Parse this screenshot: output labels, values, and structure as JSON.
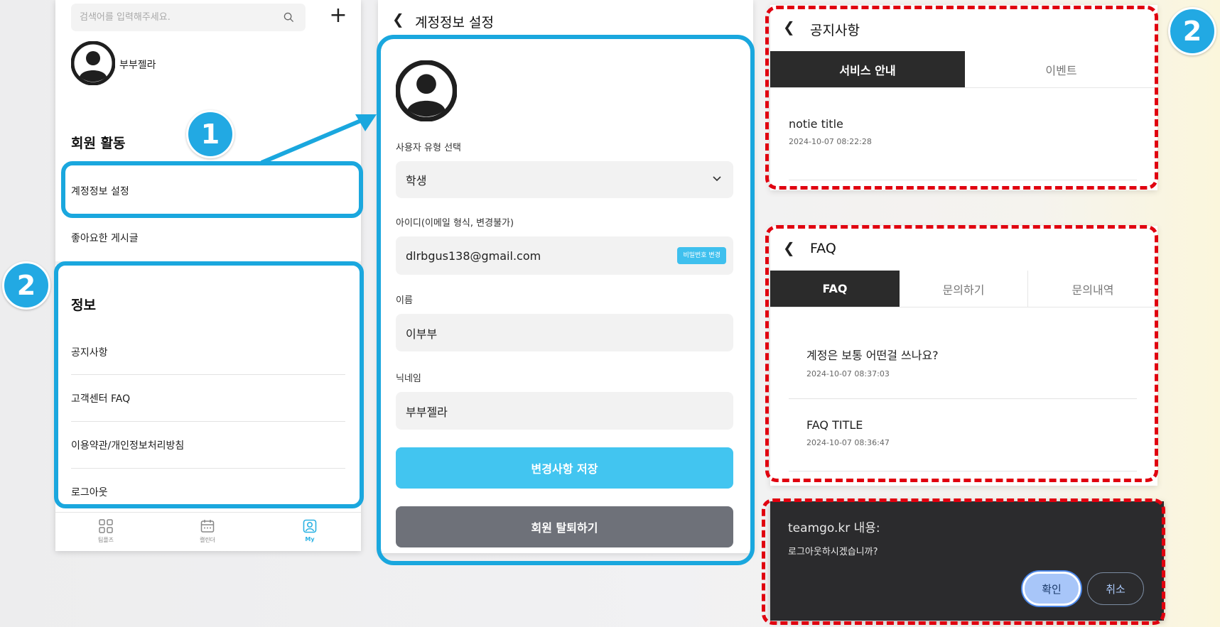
{
  "my_page": {
    "search": {
      "placeholder": "검색어를 입력해주세요."
    },
    "user": {
      "name": "부부젤라"
    },
    "sections": [
      {
        "title": "회원 활동",
        "items": [
          "계정정보 설정",
          "좋아요한 게시글"
        ]
      },
      {
        "title": "정보",
        "items": [
          "공지사항",
          "고객센터 FAQ",
          "이용약관/개인정보처리방침",
          "로그아웃"
        ]
      }
    ],
    "bottom_nav": [
      {
        "label": "팀플즈",
        "icon": "grid-icon"
      },
      {
        "label": "캘린더",
        "icon": "calendar-icon"
      },
      {
        "label": "My",
        "icon": "profile-icon",
        "active": true
      }
    ]
  },
  "account_settings": {
    "title": "계정정보 설정",
    "user_type": {
      "label": "사용자 유형 선택",
      "value": "학생"
    },
    "email": {
      "label": "아이디(이메일 형식, 변경불가)",
      "value": "dlrbgus138@gmail.com",
      "password_button": "비밀번호 변경"
    },
    "name": {
      "label": "이름",
      "value": "이부부"
    },
    "nickname": {
      "label": "닉네임",
      "value": "부부젤라"
    },
    "save_button": "변경사항 저장",
    "withdraw_button": "회원 탈퇴하기"
  },
  "notice": {
    "title": "공지사항",
    "tabs": [
      {
        "label": "서비스 안내",
        "active": true
      },
      {
        "label": "이벤트",
        "active": false
      }
    ],
    "posts": [
      {
        "title": "notie title",
        "date": "2024-10-07 08:22:28"
      }
    ]
  },
  "faq": {
    "title": "FAQ",
    "tabs": [
      {
        "label": "FAQ",
        "active": true
      },
      {
        "label": "문의하기",
        "active": false
      },
      {
        "label": "문의내역",
        "active": false
      }
    ],
    "posts": [
      {
        "title": "계정은 보통 어떤걸 쓰나요?",
        "date": "2024-10-07 08:37:03"
      },
      {
        "title": "FAQ TITLE",
        "date": "2024-10-07 08:36:47"
      }
    ]
  },
  "logout_dialog": {
    "title": "teamgo.kr 내용:",
    "message": "로그아웃하시겠습니까?",
    "confirm": "확인",
    "cancel": "취소"
  },
  "annotations": {
    "badge_1": "1",
    "badge_2": "2"
  },
  "colors": {
    "accent": "#42c5f0",
    "annotation_blue": "#1aa7de",
    "annotation_red": "#e0000f",
    "dark_tab": "#2b2b2b"
  }
}
